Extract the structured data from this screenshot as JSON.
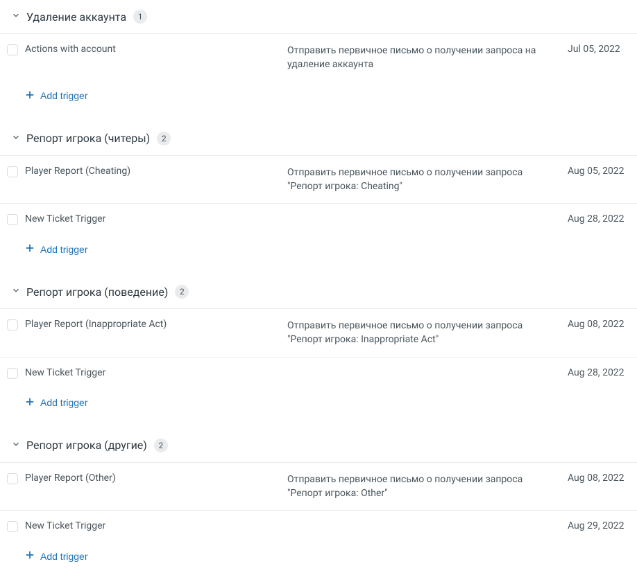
{
  "add_trigger_label": "Add trigger",
  "sections": [
    {
      "title": "Удаление аккаунта",
      "count": "1",
      "rows": [
        {
          "name": "Actions with account",
          "desc": "Отправить первичное письмо о получении запроса на удаление аккаунта",
          "date": "Jul 05, 2022"
        }
      ]
    },
    {
      "title": "Репорт игрока (читеры)",
      "count": "2",
      "rows": [
        {
          "name": "Player Report (Cheating)",
          "desc": "Отправить первичное письмо о получении запроса \"Репорт игрока: Cheating\"",
          "date": "Aug 05, 2022"
        },
        {
          "name": "New Ticket Trigger",
          "desc": "",
          "date": "Aug 28, 2022"
        }
      ]
    },
    {
      "title": "Репорт игрока (поведение)",
      "count": "2",
      "rows": [
        {
          "name": "Player Report (Inappropriate Act)",
          "desc": "Отправить первичное письмо о получении запроса \"Репорт игрока: Inappropriate Act\"",
          "date": "Aug 08, 2022"
        },
        {
          "name": "New Ticket Trigger",
          "desc": "",
          "date": "Aug 28, 2022"
        }
      ]
    },
    {
      "title": "Репорт игрока (другие)",
      "count": "2",
      "rows": [
        {
          "name": "Player Report (Other)",
          "desc": "Отправить первичное письмо о получении запроса \"Репорт игрока: Other\"",
          "date": "Aug 08, 2022"
        },
        {
          "name": "New Ticket Trigger",
          "desc": "",
          "date": "Aug 29, 2022"
        }
      ]
    }
  ]
}
